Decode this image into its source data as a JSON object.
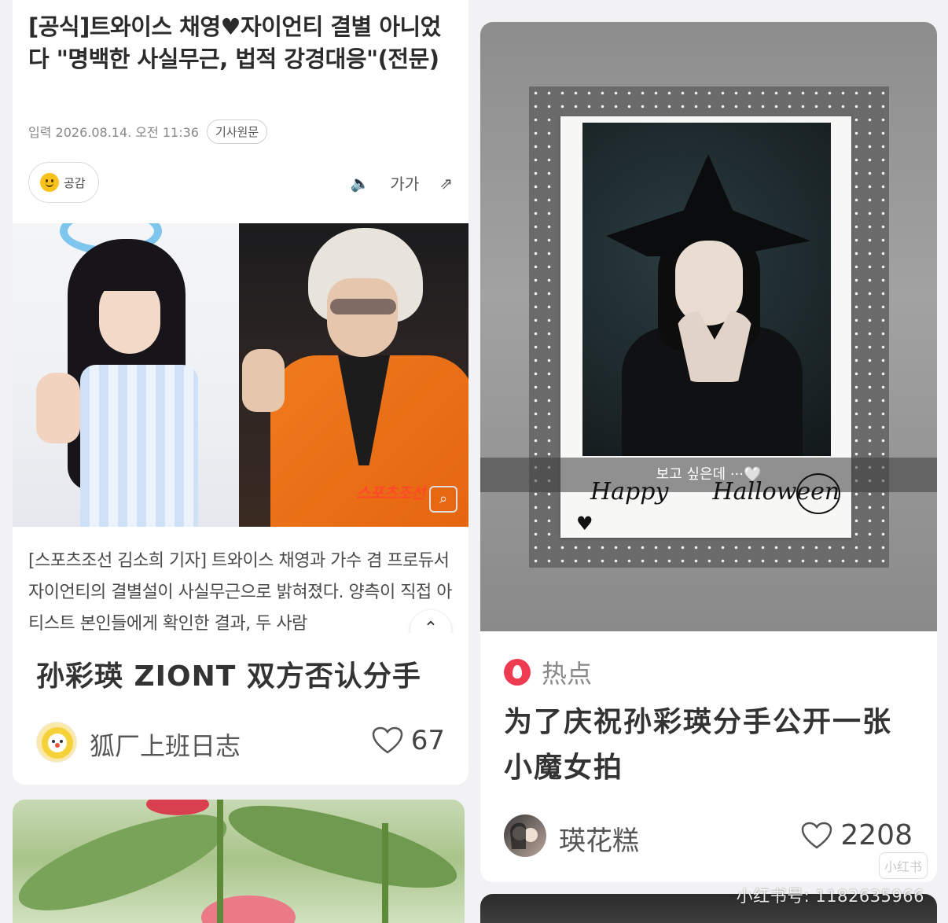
{
  "left_post": {
    "article": {
      "headline": "[공식]트와이스 채영♥자이언티 결별 아니었다 \"명백한 사실무근, 법적 강경대응\"(전문)",
      "date": "입력 2026.08.14. 오전 11:36",
      "source_chip": "기사원문",
      "react_label": "공감",
      "font_size_label": "가가",
      "photo_watermark": "스포츠조선",
      "body": "[스포츠조선 김소희 기자] 트와이스 채영과 가수 겸 프로듀서 자이언티의 결별설이 사실무근으로 밝혀졌다. 양측이 직접 아티스트 본인들에게 확인한 결과, 두 사람"
    },
    "title": "孙彩瑛 ZIONT 双方否认分手",
    "author": "狐厂上班日志",
    "likes": "67"
  },
  "right_post": {
    "image": {
      "caption": "보고 싶은데 ···🤍",
      "handwriting_1": "Happy",
      "handwriting_2": "Halloween"
    },
    "tag": "热点",
    "title": "为了庆祝孙彩瑛分手公开一张小魔女拍",
    "author": "瑛花糕",
    "likes": "2208",
    "app_logo": "小红书"
  },
  "watermark": "小红书号: 1182635966",
  "colors": {
    "background": "#f2f2f4",
    "hot_red": "#ef3b4f",
    "card": "#ffffff"
  }
}
